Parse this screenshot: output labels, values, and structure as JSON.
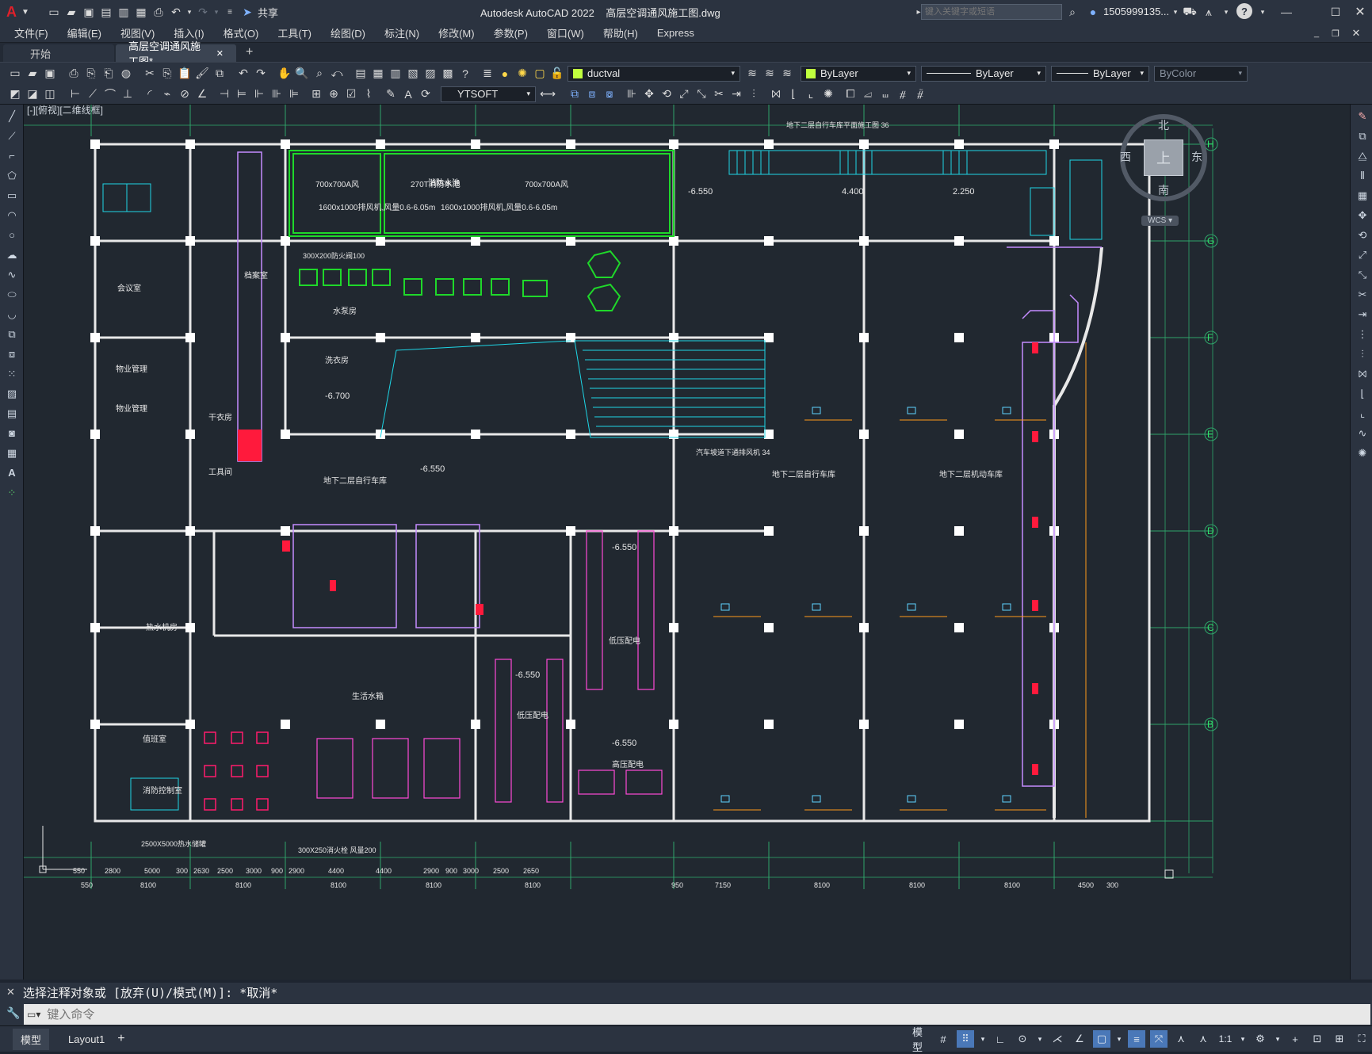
{
  "title_bar": {
    "app_logo": "A",
    "share_label": "共享",
    "window_title": "Autodesk AutoCAD 2022    高层空调通风施工图.dwg",
    "search_placeholder": "键入关键字或短语",
    "user": "1505999135...",
    "help": "?"
  },
  "menu": [
    "文件(F)",
    "编辑(E)",
    "视图(V)",
    "插入(I)",
    "格式(O)",
    "工具(T)",
    "绘图(D)",
    "标注(N)",
    "修改(M)",
    "参数(P)",
    "窗口(W)",
    "帮助(H)",
    "Express"
  ],
  "tabs": [
    {
      "label": "开始"
    },
    {
      "label": "高层空调通风施工图*"
    }
  ],
  "toolbar": {
    "layer": "ductval",
    "color": "ByLayer",
    "linetype": "ByLayer",
    "lineweight": "ByLayer",
    "plotstyle": "ByColor",
    "textstyle": "YTSOFT"
  },
  "viewport_label": "[-][俯视][二维线框]",
  "viewcube": {
    "north": "北",
    "south": "南",
    "east": "东",
    "west": "西",
    "top": "上",
    "wcs": "WCS"
  },
  "drawing": {
    "grid_right": [
      "H",
      "G",
      "F",
      "E",
      "D",
      "C",
      "B"
    ],
    "dims_bottom": [
      "550",
      "2800",
      "5000",
      "300",
      "2630",
      "2500",
      "3000",
      "900",
      "2900",
      "4400",
      "4400",
      "2900",
      "900",
      "3000",
      "2500",
      "2650"
    ],
    "dims_bottom2": [
      "550",
      "8100",
      "8100",
      "8100",
      "8100",
      "8100",
      "950",
      "7150",
      "8100",
      "8100",
      "8100",
      "4500",
      "300"
    ],
    "rooms": [
      "会议室",
      "物业管理",
      "物业管理",
      "干衣房",
      "工具间",
      "热水机房",
      "值班室",
      "消防控制室",
      "地下二层自行车库",
      "地下二层自行车库",
      "地下二层机动车库",
      "水泵房",
      "洗衣房",
      "低压配电",
      "高压配电",
      "低压配电",
      "生活水箱",
      "档案室",
      "消防水池"
    ],
    "elevations": [
      "-6.550",
      "-6.550",
      "-6.700",
      "-6.550",
      "-6.550",
      "-6.550",
      "4.400",
      "2.250"
    ],
    "notes": [
      "700x700A风",
      "270T消防水池",
      "700x700A风",
      "1600x1000排风机,风量0.6-6.05m",
      "1600x1000排风机,风量0.6-6.05m",
      "300X200防火阀100",
      "地下二层自行车库平面施工图 36",
      "汽车坡道下通排风机 34",
      "2500X5000热水储罐",
      "300X250消火栓 风量200",
      "WCS"
    ]
  },
  "command": {
    "history": "选择注释对象或 [放弃(U)/模式(M)]: *取消*",
    "placeholder": "键入命令"
  },
  "status": {
    "tabs": [
      "模型",
      "Layout1"
    ],
    "mode": "模型",
    "scale": "1:1"
  }
}
